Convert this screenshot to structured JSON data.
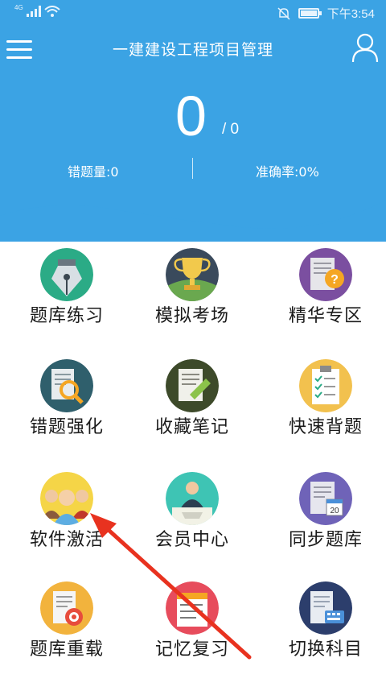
{
  "status_bar": {
    "network": "4G",
    "time": "下午3:54"
  },
  "header": {
    "title": "一建建设工程项目管理",
    "score": "0",
    "total": "/ 0",
    "wrong_count": "错题量:0",
    "accuracy": "准确率:0%"
  },
  "colors": {
    "header_bg": "#3ba3e4",
    "annotation_arrow": "#e8321f"
  },
  "grid": {
    "items": [
      {
        "label": "题库练习",
        "icon": "fountain-pen-icon"
      },
      {
        "label": "模拟考场",
        "icon": "trophy-icon"
      },
      {
        "label": "精华专区",
        "icon": "document-question-icon"
      },
      {
        "label": "错题强化",
        "icon": "document-magnifier-icon"
      },
      {
        "label": "收藏笔记",
        "icon": "notebook-pen-icon"
      },
      {
        "label": "快速背题",
        "icon": "clipboard-checklist-icon"
      },
      {
        "label": "软件激活",
        "icon": "group-people-icon"
      },
      {
        "label": "会员中心",
        "icon": "member-desk-icon"
      },
      {
        "label": "同步题库",
        "icon": "document-calendar-icon"
      },
      {
        "label": "题库重载",
        "icon": "document-target-icon"
      },
      {
        "label": "记忆复习",
        "icon": "notepad-list-icon"
      },
      {
        "label": "切换科目",
        "icon": "document-keyboard-icon"
      }
    ]
  }
}
